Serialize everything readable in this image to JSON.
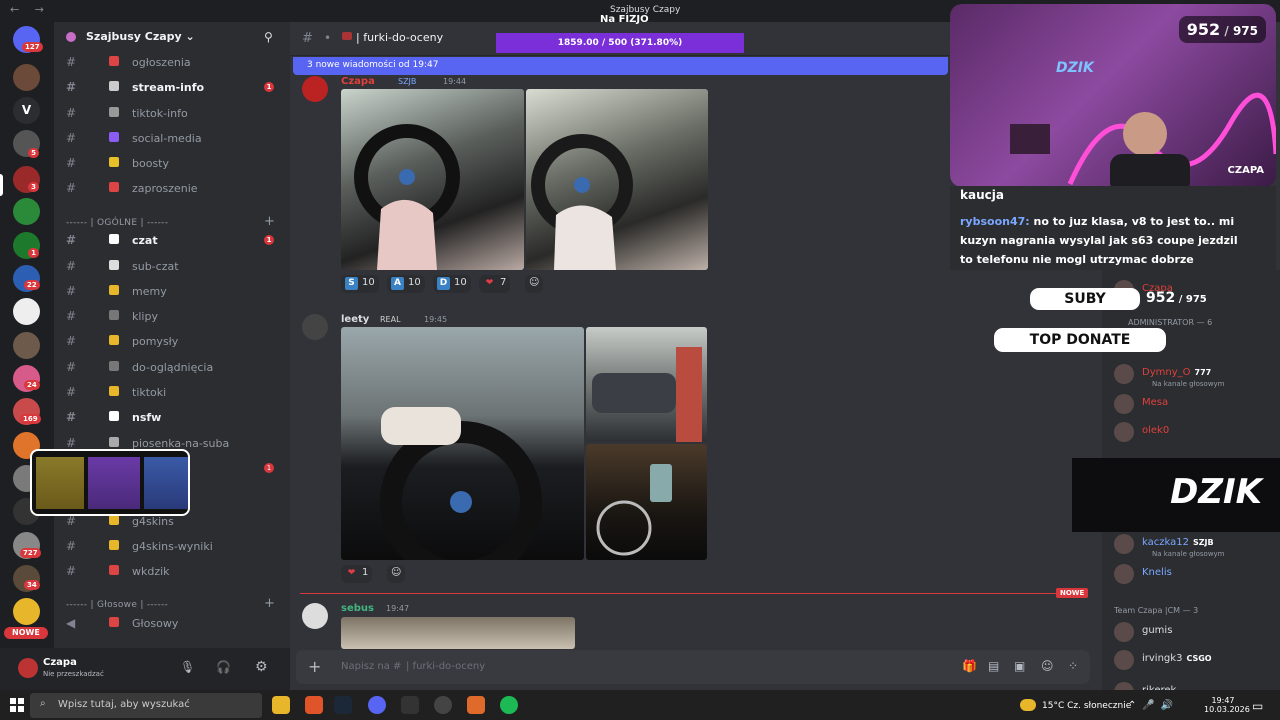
{
  "titlebar": {
    "title": "Szajbusy Czapy",
    "nav": "← →"
  },
  "server": {
    "name": "Szajbusy Czapy"
  },
  "channels": [
    {
      "name": "ogłoszenia",
      "unread": false
    },
    {
      "name": "stream-info",
      "unread": true,
      "count": "1"
    },
    {
      "name": "tiktok-info",
      "unread": false
    },
    {
      "name": "social-media",
      "unread": false
    },
    {
      "name": "boosty",
      "unread": false
    },
    {
      "name": "zaproszenie",
      "unread": false
    },
    {
      "name": "czat",
      "unread": true,
      "count": "1"
    },
    {
      "name": "sub-czat",
      "unread": false
    },
    {
      "name": "memy",
      "unread": false
    },
    {
      "name": "klipy",
      "unread": false
    },
    {
      "name": "pomysły",
      "unread": false
    },
    {
      "name": "do-oglądnięcia",
      "unread": false
    },
    {
      "name": "tiktoki",
      "unread": false
    },
    {
      "name": "nsfw",
      "unread": true
    },
    {
      "name": "piosenka-na-suba",
      "unread": false
    },
    {
      "name": "ny",
      "unread": false,
      "count": "1"
    },
    {
      "name": "g4skins",
      "unread": false
    },
    {
      "name": "g4skins-wyniki",
      "unread": false
    },
    {
      "name": "wkdzik",
      "unread": false
    },
    {
      "name": "Głosowy",
      "unread": false
    }
  ],
  "categories": {
    "general": "------ | OGÓLNE | ------",
    "voice": "------ | Głosowe | ------"
  },
  "rail_badges": [
    "127",
    "5",
    "3",
    "1",
    "22",
    "24",
    "169",
    "727",
    "34",
    "4"
  ],
  "rail_letter": "V",
  "rail_new": "NOWE",
  "user": {
    "name": "Czapa",
    "status": "Nie przeszkadzać"
  },
  "chat": {
    "channel": "furki-do-oceny",
    "new_banner": "3 nowe wiadomości od 19:47",
    "new_divider": "NOWE",
    "composer_placeholder": "Napisz na #",
    "composer_channel": "| furki-do-oceny"
  },
  "messages": [
    {
      "user": "Czapa",
      "tag": "SZJB",
      "time": "19:44",
      "reactions": [
        {
          "label": "S",
          "count": "10",
          "color": "#3b82c4"
        },
        {
          "label": "A",
          "count": "10",
          "color": "#3b82c4"
        },
        {
          "label": "D",
          "count": "10",
          "color": "#3b82c4"
        },
        {
          "label": "❤",
          "count": "7",
          "color": "#e23b4a"
        }
      ]
    },
    {
      "user": "leety",
      "tag": "REAL",
      "time": "19:45",
      "reactions": [
        {
          "label": "❤",
          "count": "1",
          "color": "#e23b4a"
        }
      ]
    },
    {
      "user": "sebus",
      "tag": "",
      "time": "19:47",
      "reactions": []
    }
  ],
  "overlay": {
    "goal_title": "Na FIZJO",
    "goal_progress": "1859.00 / 500 (371.80%)",
    "goal_fraction": 3.718,
    "subs": "952",
    "subs_goal": "975",
    "cam_name": "CZAPA",
    "cam_logo": "DZIK",
    "chat_prev": "kaucja",
    "chat_user": "rybsoon47",
    "chat_text": "no to juz klasa, v8 to jest to.. mi kuzyn nagrania wysylal jak s63 coupe jezdzil to telefonu nie mogl utrzymac dobrze",
    "suby": "SUBY",
    "top_donate": "TOP DONATE",
    "dzik_banner": "DZIK"
  },
  "members": {
    "admin_header": "ADMINISTRATOR — 6",
    "team_header": "Team Czapa |CM — 3",
    "list": [
      {
        "name": "Czapa",
        "sub": "",
        "color": "#e0403a"
      },
      {
        "name": "Dymny_O",
        "sub": "Na kanale głosowym",
        "color": "#e0403a",
        "tag": "777"
      },
      {
        "name": "Mesa",
        "sub": "",
        "color": "#e0403a"
      },
      {
        "name": "olek0",
        "sub": "",
        "color": "#e0403a"
      },
      {
        "name": "kaczka12",
        "sub": "Na kanale głosowym",
        "color": "#7aa8ff",
        "tag": "SZJB"
      },
      {
        "name": "Knelis",
        "sub": "",
        "color": "#7aa8ff"
      },
      {
        "name": "gumis",
        "sub": "",
        "color": "#dbdee1"
      },
      {
        "name": "irvingk3",
        "sub": "",
        "color": "#dbdee1",
        "tag": "CSGO"
      },
      {
        "name": "rikerek",
        "sub": "",
        "color": "#dbdee1"
      }
    ]
  },
  "taskbar": {
    "search_placeholder": "Wpisz tutaj, aby wyszukać",
    "weather": "15°C  Cz. słonecznie",
    "time": "19:47",
    "date": "10.03.2026"
  },
  "colors": {
    "accent": "#5865f2",
    "goal": "#7b2fd8",
    "danger": "#da373c"
  }
}
